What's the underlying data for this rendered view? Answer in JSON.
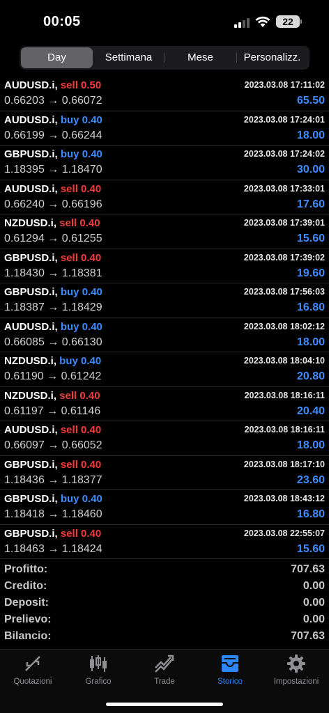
{
  "status_bar": {
    "time": "00:05",
    "battery": "22"
  },
  "period_tabs": [
    {
      "label": "Day",
      "active": true
    },
    {
      "label": "Settimana",
      "active": false
    },
    {
      "label": "Mese",
      "active": false
    },
    {
      "label": "Personalizz.",
      "active": false
    }
  ],
  "deals": [
    {
      "symbol": "AUDUSD.i,",
      "side": "sell",
      "volume_label": "sell 0.50",
      "time": "2023.03.08 17:11:02",
      "open": "0.66203",
      "close": "0.66072",
      "profit": "65.50"
    },
    {
      "symbol": "AUDUSD.i,",
      "side": "buy",
      "volume_label": "buy 0.40",
      "time": "2023.03.08 17:24:01",
      "open": "0.66199",
      "close": "0.66244",
      "profit": "18.00"
    },
    {
      "symbol": "GBPUSD.i,",
      "side": "buy",
      "volume_label": "buy 0.40",
      "time": "2023.03.08 17:24:02",
      "open": "1.18395",
      "close": "1.18470",
      "profit": "30.00"
    },
    {
      "symbol": "AUDUSD.i,",
      "side": "sell",
      "volume_label": "sell 0.40",
      "time": "2023.03.08 17:33:01",
      "open": "0.66240",
      "close": "0.66196",
      "profit": "17.60"
    },
    {
      "symbol": "NZDUSD.i,",
      "side": "sell",
      "volume_label": "sell 0.40",
      "time": "2023.03.08 17:39:01",
      "open": "0.61294",
      "close": "0.61255",
      "profit": "15.60"
    },
    {
      "symbol": "GBPUSD.i,",
      "side": "sell",
      "volume_label": "sell 0.40",
      "time": "2023.03.08 17:39:02",
      "open": "1.18430",
      "close": "1.18381",
      "profit": "19.60"
    },
    {
      "symbol": "GBPUSD.i,",
      "side": "buy",
      "volume_label": "buy 0.40",
      "time": "2023.03.08 17:56:03",
      "open": "1.18387",
      "close": "1.18429",
      "profit": "16.80"
    },
    {
      "symbol": "AUDUSD.i,",
      "side": "buy",
      "volume_label": "buy 0.40",
      "time": "2023.03.08 18:02:12",
      "open": "0.66085",
      "close": "0.66130",
      "profit": "18.00"
    },
    {
      "symbol": "NZDUSD.i,",
      "side": "buy",
      "volume_label": "buy 0.40",
      "time": "2023.03.08 18:04:10",
      "open": "0.61190",
      "close": "0.61242",
      "profit": "20.80"
    },
    {
      "symbol": "NZDUSD.i,",
      "side": "sell",
      "volume_label": "sell 0.40",
      "time": "2023.03.08 18:16:11",
      "open": "0.61197",
      "close": "0.61146",
      "profit": "20.40"
    },
    {
      "symbol": "AUDUSD.i,",
      "side": "sell",
      "volume_label": "sell 0.40",
      "time": "2023.03.08 18:16:11",
      "open": "0.66097",
      "close": "0.66052",
      "profit": "18.00"
    },
    {
      "symbol": "GBPUSD.i,",
      "side": "sell",
      "volume_label": "sell 0.40",
      "time": "2023.03.08 18:17:10",
      "open": "1.18436",
      "close": "1.18377",
      "profit": "23.60"
    },
    {
      "symbol": "GBPUSD.i,",
      "side": "buy",
      "volume_label": "buy 0.40",
      "time": "2023.03.08 18:43:12",
      "open": "1.18418",
      "close": "1.18460",
      "profit": "16.80"
    },
    {
      "symbol": "GBPUSD.i,",
      "side": "sell",
      "volume_label": "sell 0.40",
      "time": "2023.03.08 22:55:07",
      "open": "1.18463",
      "close": "1.18424",
      "profit": "15.60"
    }
  ],
  "summary": [
    {
      "label": "Profitto:",
      "value": "707.63"
    },
    {
      "label": "Credito:",
      "value": "0.00"
    },
    {
      "label": "Deposit:",
      "value": "0.00"
    },
    {
      "label": "Prelievo:",
      "value": "0.00"
    },
    {
      "label": "Bilancio:",
      "value": "707.63"
    }
  ],
  "tabbar": [
    {
      "label": "Quotazioni",
      "icon": "quotes-icon",
      "active": false
    },
    {
      "label": "Grafico",
      "icon": "chart-icon",
      "active": false
    },
    {
      "label": "Trade",
      "icon": "trade-icon",
      "active": false
    },
    {
      "label": "Storico",
      "icon": "history-icon",
      "active": true
    },
    {
      "label": "Impostazioni",
      "icon": "settings-icon",
      "active": false
    }
  ],
  "colors": {
    "sell": "#f23c3c",
    "buy": "#3d8bff",
    "profit": "#3d8bff",
    "active_tab": "#2f86f6"
  }
}
